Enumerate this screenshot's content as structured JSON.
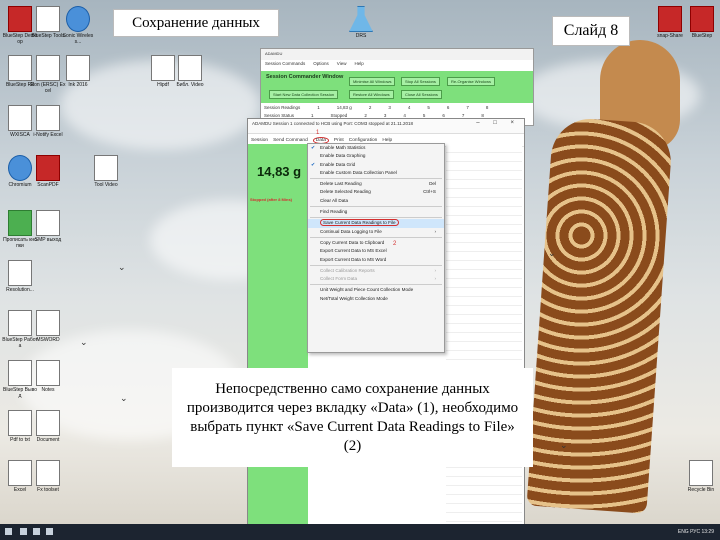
{
  "slide": {
    "title": "Сохранение данных",
    "number": "Слайд 8",
    "caption": "Непосредственно само сохранение данных производится через вкладку «Data» (1), необходимо выбрать пункт «Save Current Data Readings to File» (2)"
  },
  "desktop_icons": [
    {
      "label": "BlueStep Desktop",
      "style": "red"
    },
    {
      "label": "BlueStep Tools",
      "style": "white"
    },
    {
      "label": "Sonic Wireless...",
      "style": "blue"
    },
    {
      "label": "BlueStep R3",
      "style": "white"
    },
    {
      "label": "Ron (ERSC) Excel",
      "style": "white"
    },
    {
      "label": "Ink 2016",
      "style": "white"
    },
    {
      "label": "WXISCA",
      "style": "white"
    },
    {
      "label": "i-Notify Excel",
      "style": "white"
    },
    {
      "label": "Chromium",
      "style": "blue"
    },
    {
      "label": "ScanPDF",
      "style": "red"
    },
    {
      "label": "Прописать кнопки",
      "style": "green"
    },
    {
      "label": "SMP выход",
      "style": "white"
    },
    {
      "label": "Resolution...",
      "style": "white"
    },
    {
      "label": "BlueStep Работа",
      "style": "white"
    },
    {
      "label": "MSWORD",
      "style": "white"
    },
    {
      "label": "BlueStep Вывод",
      "style": "white"
    },
    {
      "label": "Notes",
      "style": "white"
    },
    {
      "label": "Pdf to txt",
      "style": "white"
    },
    {
      "label": "Document",
      "style": "white"
    },
    {
      "label": "Excel",
      "style": "white"
    },
    {
      "label": "Fx toolset",
      "style": "white"
    },
    {
      "label": "Hipdf",
      "style": "white"
    },
    {
      "label": "Библ. Video",
      "style": "white"
    },
    {
      "label": "Tool Video",
      "style": "white"
    },
    {
      "label": "Recycle Bin",
      "style": "white"
    },
    {
      "label": "DRS",
      "style": "flask"
    },
    {
      "label": "snap-Share",
      "style": "red"
    },
    {
      "label": "BlueStep",
      "style": "red"
    }
  ],
  "cmd_window": {
    "title": "ADAMDU",
    "menu": [
      "Session Commands",
      "Options",
      "View",
      "Help"
    ],
    "header": "Session Commander Window",
    "buttons": [
      "Start New Data Collection Session",
      "Minimise All Windows",
      "Stop All Sessions",
      "Restore All Windows",
      "Close All Sessions",
      "Re-Organise Windows"
    ],
    "rows": [
      {
        "label": "Session Readings",
        "values": [
          "1",
          "14,83 g",
          "2",
          "3",
          "4",
          "5",
          "6",
          "7",
          "8"
        ]
      },
      {
        "label": "Session Status",
        "values": [
          "1",
          "Stopped",
          "2",
          "3",
          "4",
          "5",
          "6",
          "7",
          "8"
        ]
      }
    ]
  },
  "main_window": {
    "title": "ADAMDU Session 1 connected to HCB using Port: COM3 stopped at 21.11.2018",
    "controls": "– □ ×",
    "menu": [
      "Session",
      "Send Command",
      "Data",
      "Print",
      "Configuration",
      "Help"
    ],
    "weight": "14,83 g",
    "status": "Stopped (after 8 Mins)",
    "annotation_1": "1",
    "annotation_2": "2"
  },
  "data_menu": [
    {
      "label": "Enable Math Statistics",
      "checked": true,
      "shortcut": "",
      "disabled": false
    },
    {
      "label": "Enable Data Graphing",
      "checked": false,
      "shortcut": "",
      "disabled": false
    },
    {
      "label": "Enable Data Grid",
      "checked": true,
      "shortcut": "",
      "disabled": false
    },
    {
      "label": "Enable Custom Data Collection Panel",
      "checked": false,
      "shortcut": "",
      "disabled": false,
      "sep_after": true
    },
    {
      "label": "Delete Last Reading",
      "checked": false,
      "shortcut": "Del",
      "disabled": false
    },
    {
      "label": "Delete Selected Reading",
      "checked": false,
      "shortcut": "Ctrl+S",
      "disabled": false
    },
    {
      "label": "Clear All Data",
      "checked": false,
      "shortcut": "",
      "disabled": false,
      "sep_after": true
    },
    {
      "label": "Find Reading",
      "checked": false,
      "shortcut": "",
      "disabled": false,
      "sep_after": true
    },
    {
      "label": "Save Current Data Readings to File",
      "checked": false,
      "shortcut": "",
      "disabled": false,
      "highlight": true
    },
    {
      "label": "Continual Data Logging to File",
      "checked": false,
      "shortcut": "›",
      "disabled": false,
      "sep_after": true
    },
    {
      "label": "Copy Current Data to Clipboard",
      "checked": false,
      "shortcut": "",
      "disabled": false
    },
    {
      "label": "Export Current Data to MS Excel",
      "checked": false,
      "shortcut": "",
      "disabled": false
    },
    {
      "label": "Export Current Data to MS Word",
      "checked": false,
      "shortcut": "",
      "disabled": false,
      "sep_after": true
    },
    {
      "label": "Collect Calibration Reports",
      "checked": false,
      "shortcut": "›",
      "disabled": true
    },
    {
      "label": "Collect Form Data",
      "checked": false,
      "shortcut": "›",
      "disabled": true,
      "sep_after": true
    },
    {
      "label": "Unit Weight and Piece Count Collection Mode",
      "checked": false,
      "shortcut": "",
      "disabled": false
    },
    {
      "label": "Net/Total Weight Collection Mode",
      "checked": false,
      "shortcut": "",
      "disabled": false
    }
  ],
  "taskbar": {
    "tray": "ENG   РУС   13:29"
  }
}
